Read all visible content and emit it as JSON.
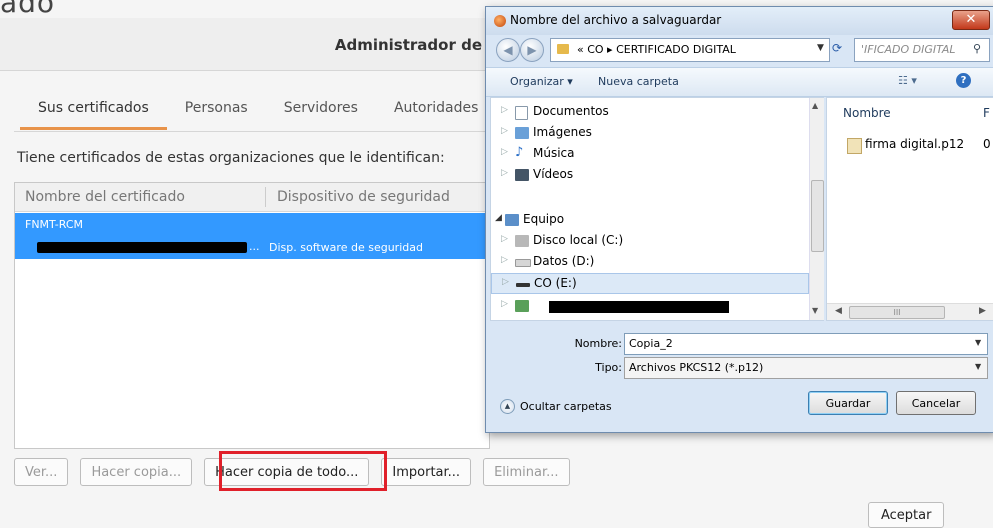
{
  "background": {
    "partial_title": "ado",
    "manager_title": "Administrador de",
    "tabs": [
      {
        "label": "Sus certificados",
        "active": true
      },
      {
        "label": "Personas",
        "active": false
      },
      {
        "label": "Servidores",
        "active": false
      },
      {
        "label": "Autoridades",
        "active": false
      }
    ],
    "intro_text": "Tiene certificados de estas organizaciones que le identifican:",
    "table": {
      "columns": [
        "Nombre del certificado",
        "Dispositivo de seguridad"
      ],
      "group_row": "FNMT-RCM",
      "cert_row": {
        "name_ellipsis": "...",
        "device": "Disp. software de seguridad"
      }
    },
    "buttons": {
      "view": "Ver...",
      "backup": "Hacer copia...",
      "backup_all": "Hacer copia de todo...",
      "import": "Importar...",
      "delete": "Eliminar...",
      "ok": "Aceptar"
    },
    "highlight_color": "#e0202a",
    "accent_color": "#e8934a",
    "selection_color": "#3399ff"
  },
  "dialog": {
    "title": "Nombre del archivo a salvaguardar",
    "close_glyph": "✕",
    "address": {
      "text": "«  CO  ▸  CERTIFICADO DIGITAL",
      "search_placeholder": "'IFICADO DIGITAL"
    },
    "toolbar": {
      "organize": "Organizar ▾",
      "new_folder": "Nueva carpeta",
      "view_glyph": "☷ ▾",
      "help_glyph": "?"
    },
    "nav_tree": [
      {
        "label": "Documentos",
        "icon": "documents-icon"
      },
      {
        "label": "Imágenes",
        "icon": "images-icon"
      },
      {
        "label": "Música",
        "icon": "music-icon"
      },
      {
        "label": "Vídeos",
        "icon": "videos-icon"
      },
      {
        "label": "Equipo",
        "icon": "computer-icon"
      },
      {
        "label": "Disco local (C:)",
        "icon": "local-disk-icon"
      },
      {
        "label": "Datos (D:)",
        "icon": "drive-icon"
      },
      {
        "label": "CO (E:)",
        "icon": "usb-drive-icon"
      }
    ],
    "file_list": {
      "column": "Nombre",
      "column2": "F",
      "files": [
        {
          "name": "firma digital.p12",
          "col2": "0"
        }
      ],
      "hscroll_grip": "III"
    },
    "filename_label": "Nombre:",
    "filename_value": "Copia_2",
    "type_label": "Tipo:",
    "type_value": "Archivos PKCS12 (*.p12)",
    "hide_folders": "Ocultar carpetas",
    "save": "Guardar",
    "cancel": "Cancelar"
  }
}
